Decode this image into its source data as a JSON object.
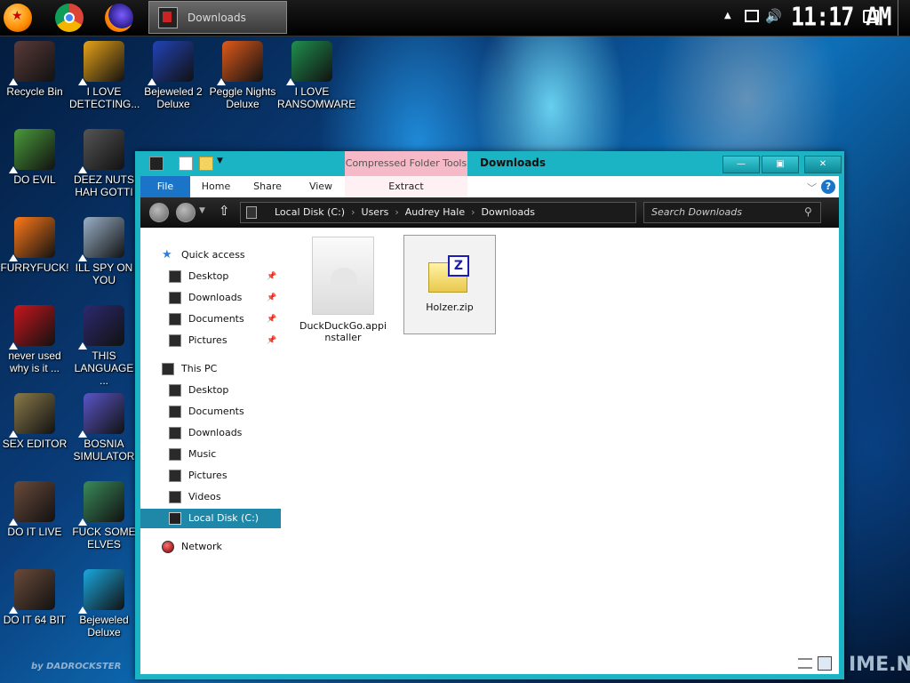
{
  "taskbar": {
    "task_label": "Downloads",
    "clock": "11:17 AM",
    "pins": [
      "dragonball-icon",
      "chrome-icon",
      "firefox-icon"
    ]
  },
  "desktop": {
    "icons": [
      {
        "label": "Recycle Bin",
        "color": "#5a3a3a"
      },
      {
        "label": "I LOVE DETECTING...",
        "color": "#e8a317"
      },
      {
        "label": "Bejeweled 2 Deluxe",
        "color": "#2243b8"
      },
      {
        "label": "Peggle Nights Deluxe",
        "color": "#e05a1a"
      },
      {
        "label": "I LOVE RANSOMWARE",
        "color": "#1f8f4e"
      },
      {
        "label": "DO EVIL",
        "color": "#4a9a3a"
      },
      {
        "label": "DEEZ NUTS HAH GOTTI",
        "color": "#555555"
      },
      {
        "label": "FURRYFUCK!",
        "color": "#ff7a18"
      },
      {
        "label": "ILL SPY ON YOU",
        "color": "#9ab0c8"
      },
      {
        "label": "never used why is it ...",
        "color": "#c8161d"
      },
      {
        "label": "THIS LANGUAGE ...",
        "color": "#2c2a6e"
      },
      {
        "label": "SEX EDITOR",
        "color": "#8a7a4a"
      },
      {
        "label": "BOSNIA SIMULATOR",
        "color": "#5a56c8"
      },
      {
        "label": "DO IT LIVE",
        "color": "#6a4a3a"
      },
      {
        "label": "FUCK SOME ELVES",
        "color": "#3a8a5a"
      },
      {
        "label": "DO IT 64 BIT",
        "color": "#6a4a3a"
      },
      {
        "label": "Bejeweled Deluxe",
        "color": "#1aa8e0"
      }
    ]
  },
  "window": {
    "title": "Downloads",
    "context_tab": "Compressed Folder Tools",
    "ribbon": {
      "file": "File",
      "home": "Home",
      "share": "Share",
      "view": "View",
      "extract": "Extract"
    },
    "help": "?",
    "breadcrumb": [
      "Local Disk (C:)",
      "Users",
      "Audrey Hale",
      "Downloads"
    ],
    "search_placeholder": "Search Downloads",
    "nav": {
      "quick_access": "Quick access",
      "quick": [
        "Desktop",
        "Downloads",
        "Documents",
        "Pictures"
      ],
      "this_pc": "This PC",
      "pc": [
        "Desktop",
        "Documents",
        "Downloads",
        "Music",
        "Pictures",
        "Videos",
        "Local Disk (C:)"
      ],
      "network": "Network"
    },
    "files": [
      {
        "name": "DuckDuckGo.appinstaller"
      },
      {
        "name": "Holzer.zip"
      }
    ]
  },
  "watermarks": {
    "right": "IME.NET",
    "left": "by DADROCKSTER"
  }
}
